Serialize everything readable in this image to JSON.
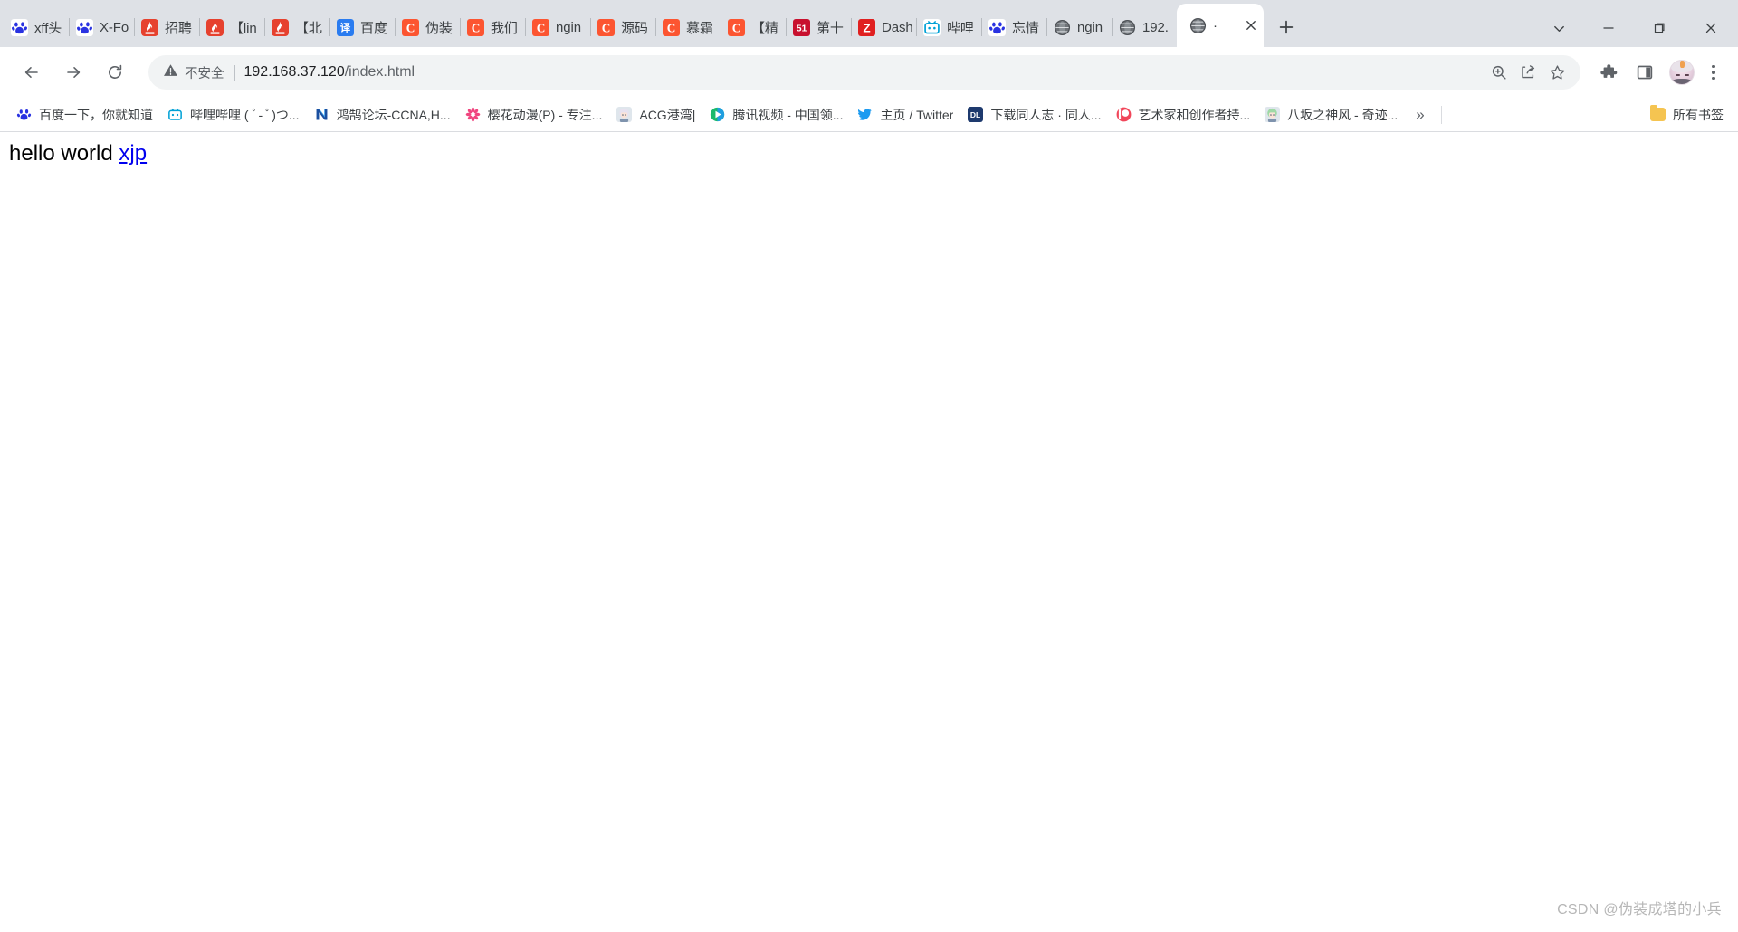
{
  "window": {
    "controls": {
      "tab_search": "tab-search-chevron",
      "minimize": "minimize",
      "maximize": "maximize",
      "close": "close"
    },
    "new_tab_label": "+"
  },
  "tabs": [
    {
      "title": "xff头",
      "icon": "baidu-icon",
      "active": false
    },
    {
      "title": "X-Fo",
      "icon": "baidu-icon",
      "active": false
    },
    {
      "title": "招聘",
      "icon": "51job-icon",
      "active": false
    },
    {
      "title": "【lin",
      "icon": "51job-icon",
      "active": false
    },
    {
      "title": "【北",
      "icon": "51job-icon",
      "active": false
    },
    {
      "title": "百度",
      "icon": "fanyi-icon",
      "active": false
    },
    {
      "title": "伪装",
      "icon": "csdn-icon",
      "active": false
    },
    {
      "title": "我们",
      "icon": "csdn-icon",
      "active": false
    },
    {
      "title": "ngin",
      "icon": "csdn-icon",
      "active": false
    },
    {
      "title": "源码",
      "icon": "csdn-icon",
      "active": false
    },
    {
      "title": "慕霜",
      "icon": "csdn-icon",
      "active": false
    },
    {
      "title": "【精",
      "icon": "csdn-icon",
      "active": false
    },
    {
      "title": "第十",
      "icon": "51cto-icon",
      "active": false
    },
    {
      "title": "Dash",
      "icon": "zhihu-icon",
      "active": false
    },
    {
      "title": "哔哩",
      "icon": "bilibili-icon",
      "active": false
    },
    {
      "title": "忘情",
      "icon": "baidu-icon",
      "active": false
    },
    {
      "title": "ngin",
      "icon": "globe-icon",
      "active": false
    },
    {
      "title": "192.",
      "icon": "globe-icon",
      "active": false
    },
    {
      "title": "·",
      "icon": "globe-icon",
      "active": true
    }
  ],
  "toolbar": {
    "back": "back-arrow",
    "forward": "forward-arrow",
    "reload": "reload",
    "security_label": "不安全",
    "url_host": "192.168.37.120",
    "url_path": "/index.html",
    "url_full": "192.168.37.120/index.html",
    "zoom_icon": "zoom-icon",
    "share_icon": "share-icon",
    "bookmark_icon": "star-icon",
    "extensions_icon": "puzzle-icon",
    "side_panel_icon": "side-panel-icon",
    "profile_icon": "avatar",
    "menu_icon": "three-dot-menu"
  },
  "bookmarks": {
    "items": [
      {
        "label": "百度一下，你就知道",
        "icon": "baidu-icon"
      },
      {
        "label": "哔哩哔哩 ( ﾟ- ﾟ)つ...",
        "icon": "bilibili-icon"
      },
      {
        "label": "鸿鹄论坛-CCNA,H...",
        "icon": "honghu-icon"
      },
      {
        "label": "樱花动漫(P) - 专注...",
        "icon": "sakura-icon"
      },
      {
        "label": "ACG港湾|",
        "icon": "acg-icon"
      },
      {
        "label": "腾讯视频 - 中国领...",
        "icon": "tencent-video-icon"
      },
      {
        "label": "主页 / Twitter",
        "icon": "twitter-icon"
      },
      {
        "label": "下载同人志 · 同人...",
        "icon": "dl-icon"
      },
      {
        "label": "艺术家和创作者持...",
        "icon": "patreon-icon"
      },
      {
        "label": "八坂之神风 - 奇迹...",
        "icon": "yasaka-icon"
      }
    ],
    "overflow_label": "»",
    "all_bookmarks_label": "所有书签"
  },
  "page": {
    "text": "hello world",
    "link_text": "xjp",
    "watermark": "CSDN @伪装成塔的小兵"
  },
  "colors": {
    "tabstrip_bg": "#dee1e6",
    "toolbar_bg": "#ffffff",
    "omnibox_bg": "#f1f3f4",
    "link": "#0000ee",
    "csdn_orange": "#fc5531",
    "bilibili_cyan": "#00a1d6",
    "baidu_blue": "#2932e1"
  }
}
